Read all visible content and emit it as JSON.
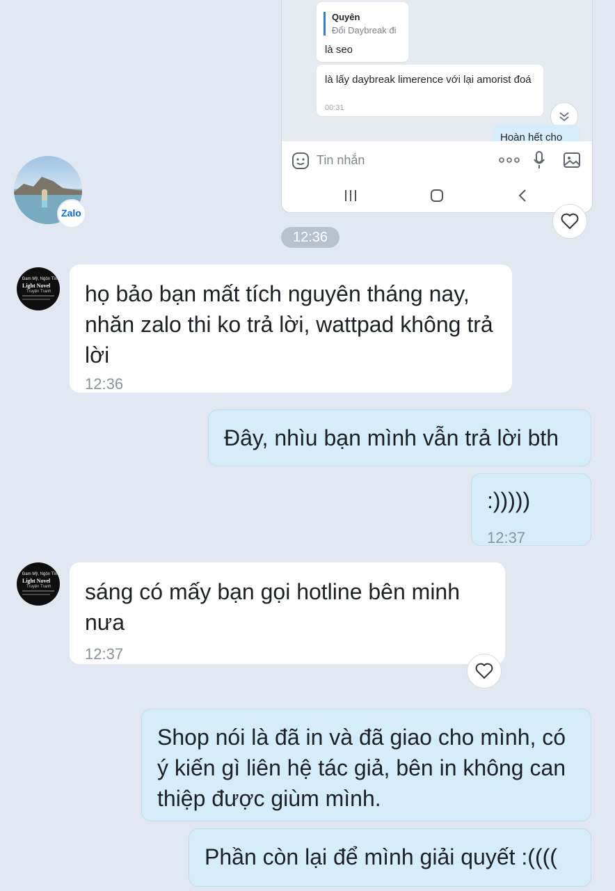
{
  "embedded_screenshot": {
    "quote_name": "Quyên",
    "quote_text": "Đổi Daybreak đi",
    "reply_text": "là seo",
    "message_text": "là lấy daybreak limerence với lại amorist đoá",
    "message_time": "00:31",
    "partial_message": "Hoàn hết cho",
    "input_placeholder": "Tin nhắn"
  },
  "profile": {
    "badge_label": "Zalo"
  },
  "time_divider": "12:36",
  "sender_avatar": {
    "line1": "Đam Mỹ, Ngôn Tình",
    "line2": "Light Novel",
    "line3": "Truyện Tranh"
  },
  "messages": [
    {
      "text": "họ bảo bạn mất tích nguyên tháng nay, nhăn zalo thi ko trả lời, wattpad không trả lời",
      "time": "12:36"
    },
    {
      "text": "Đây, nhìu bạn mình vẫn trả lời bth"
    },
    {
      "text": ":)))))",
      "time": "12:37"
    },
    {
      "text": "sáng có mấy bạn gọi hotline bên minh nưa",
      "time": "12:37"
    },
    {
      "text": "Shop nói là đã in và đã giao cho mình, có ý kiến gì liên hệ tác giả, bên in không can thiệp được giùm mình."
    },
    {
      "text": "Phần còn lại để mình giải quyết :(((("
    }
  ],
  "colors": {
    "background": "#e2e8f1",
    "outgoing_bubble": "#d5ecfb",
    "incoming_bubble": "#ffffff",
    "accent": "#0068ff"
  }
}
